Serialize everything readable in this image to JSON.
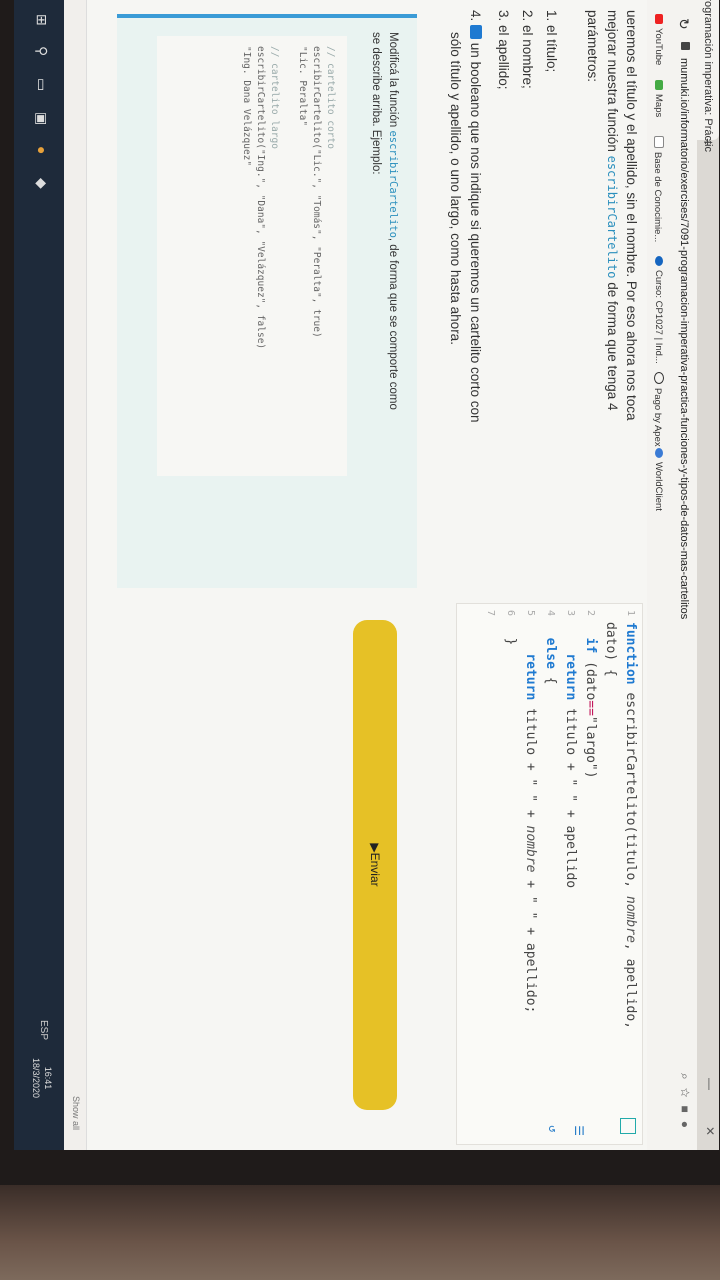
{
  "browser": {
    "tab_title": "Programación imperativa: Práctic",
    "new_tab": "+",
    "url": "mumuki.io/informatorio/exercises/7091-programacion-imperativa-practica-funciones-y-tipos-de-datos-mas-cartelitos",
    "bookmarks": [
      "YouTube",
      "Maps",
      "Base de Conocimie...",
      "Curso: CP1027 | Ind...",
      "Pago by Apex",
      "WorldClient"
    ]
  },
  "page": {
    "intro_line1": "ueremos el título y el apellido, sin el nombre. Por eso ahora nos toca",
    "intro_line2_prefix": "mejorar nuestra función",
    "intro_fn": "escribirCartelito",
    "intro_line2_suffix": "de forma que tenga 4",
    "intro_line3": "parámetros:",
    "params": [
      "1. el título;",
      "2. el nombre;",
      "3. el apellido;"
    ],
    "item4_prefix": "4.",
    "item4_text": "un booleano que nos indique si queremos un cartelito corto con",
    "item4_text2": "sólo título y apellido, o uno largo, como hasta ahora."
  },
  "editor": {
    "lines": [
      {
        "n": "1",
        "code": "function escribirCartelito(titulo, nombre, apellido,"
      },
      {
        "n": "",
        "code": "dato) {"
      },
      {
        "n": "2",
        "code": "  if (dato==\"largo\")"
      },
      {
        "n": "3",
        "code": "    return titulo + \" \" + apellido"
      },
      {
        "n": "4",
        "code": "  else {"
      },
      {
        "n": "5",
        "code": "    return titulo + \" \" + nombre + \" \" + apellido;"
      },
      {
        "n": "6",
        "code": "  }"
      },
      {
        "n": "7",
        "code": ""
      }
    ]
  },
  "exercise": {
    "text1_prefix": "Modificá la función",
    "text1_fn": "escribirCartelito",
    "text1_suffix": ", de forma que se comporte como",
    "text2": "se describe arriba. Ejemplo:",
    "code": [
      "// cartelito corto",
      "escribirCartelito(\"Lic.\", \"Tomás\", \"Peralta\", true)",
      "\"Lic. Peralta\"",
      "",
      "// cartelito largo",
      "escribirCartelito(\"Ing.\", \"Dana\", \"Velázquez\", false)",
      "\"Ing. Dana Velázquez\""
    ],
    "submit": "▶Enviar"
  },
  "taskbar": {
    "time": "16:41",
    "date": "18/3/2020",
    "lang": "ESP",
    "show_all": "Show all"
  }
}
